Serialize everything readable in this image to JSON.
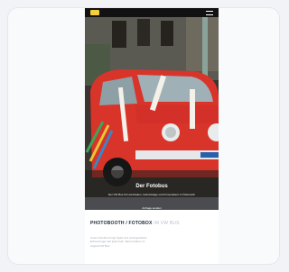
{
  "hero": {
    "title": "Der Fotobus",
    "subtitle": "Der VW Bus für Hochzeiten, Geburtstage und Firmenfeiern in Österreich",
    "meta_line1": "Anfrage senden",
    "meta_line2": "mehr erfahren"
  },
  "section": {
    "heading_main": "PHOTOBOOTH / FOTOBOX",
    "heading_light": "IM VW BUS",
    "body": "Unser Fotobus bringt Spaß und unvergessliche Erinnerungen auf jede Feier. Eine Fotobox im original VW Bus."
  },
  "colors": {
    "accent": "#f5cf2e",
    "van_red": "#d8342a"
  }
}
